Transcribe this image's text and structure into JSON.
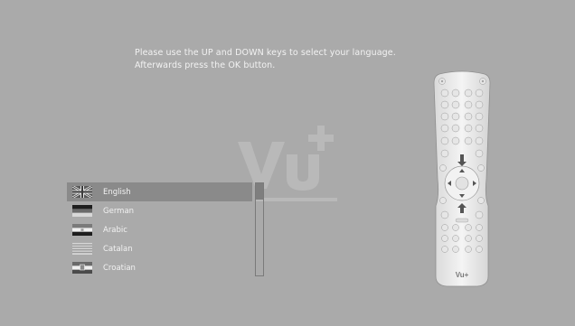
{
  "instructions": {
    "line1": "Please use the UP and DOWN keys to select your language.",
    "line2": "Afterwards press the OK button."
  },
  "languages": [
    {
      "label": "English",
      "flag": "uk-flag-icon",
      "selected": true
    },
    {
      "label": "German",
      "flag": "germany-flag-icon",
      "selected": false
    },
    {
      "label": "Arabic",
      "flag": "arabic-flag-icon",
      "selected": false
    },
    {
      "label": "Catalan",
      "flag": "catalan-flag-icon",
      "selected": false
    },
    {
      "label": "Croatian",
      "flag": "croatia-flag-icon",
      "selected": false
    }
  ],
  "remote": {
    "brand": "Vu+"
  },
  "colors": {
    "background": "#aaaaaa",
    "text": "#f2f2f2",
    "selection": "#8a8a8a",
    "remote_body": "#e9e9e9"
  }
}
